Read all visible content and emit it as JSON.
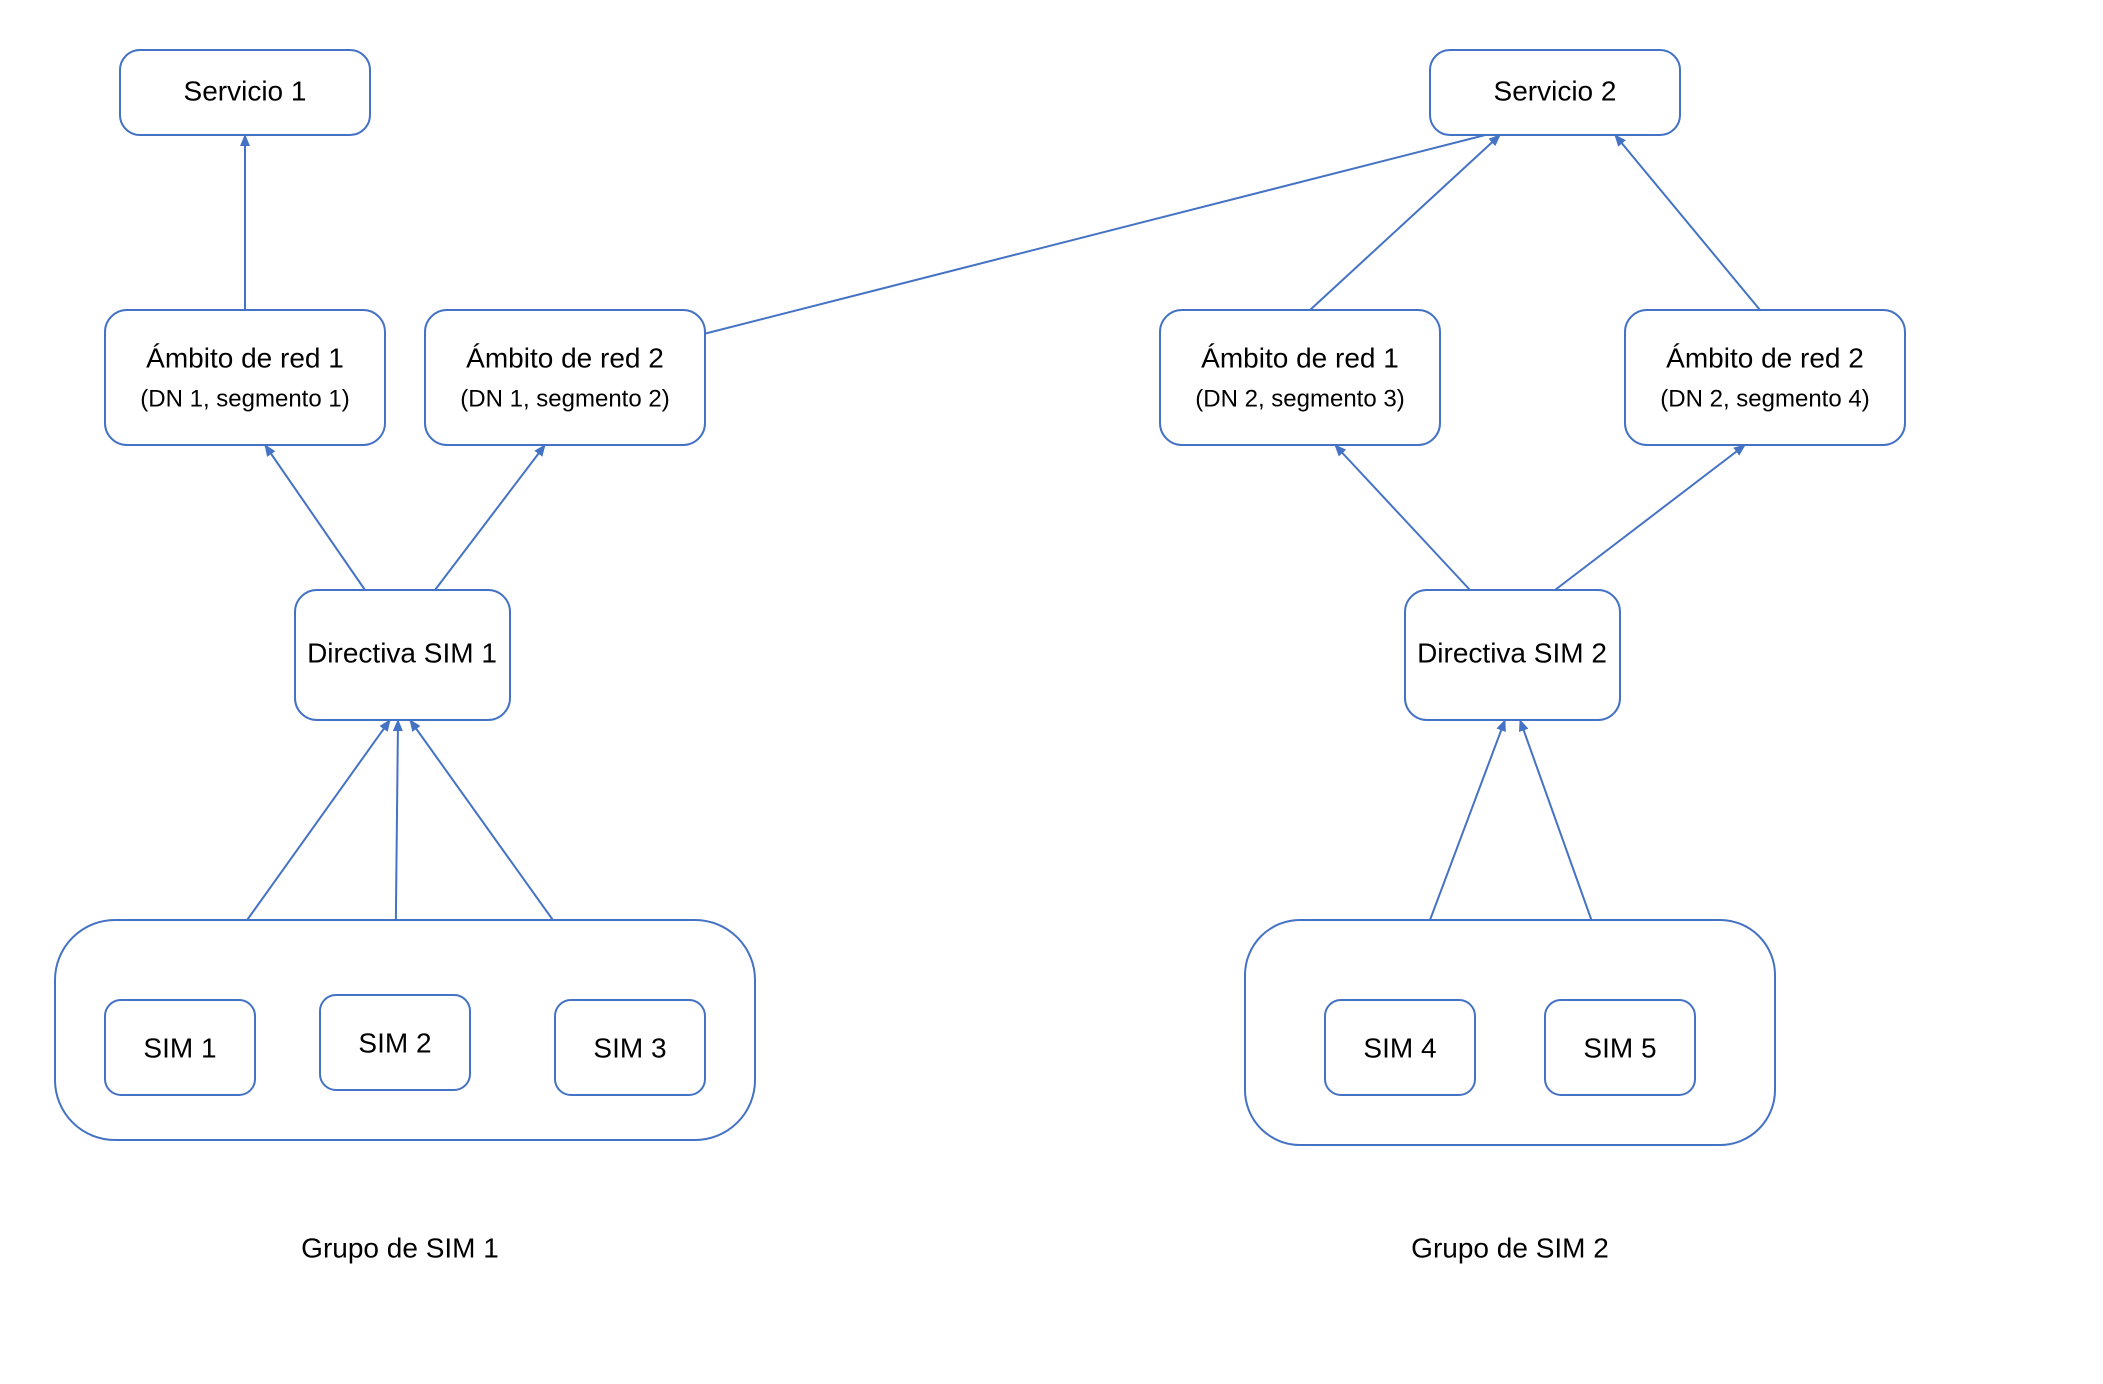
{
  "colors": {
    "stroke": "#4472C4",
    "text": "#000000"
  },
  "nodes": {
    "service1": {
      "label": "Servicio 1"
    },
    "service2": {
      "label": "Servicio 2"
    },
    "scope1_1": {
      "title": "Ámbito de red 1",
      "sub": "(DN 1, segmento 1)"
    },
    "scope1_2": {
      "title": "Ámbito de red 2",
      "sub": "(DN 1, segmento 2)"
    },
    "scope2_1": {
      "title": "Ámbito de red 1",
      "sub": "(DN 2, segmento 3)"
    },
    "scope2_2": {
      "title": "Ámbito de red 2",
      "sub": "(DN 2, segmento 4)"
    },
    "policy1": {
      "label": "Directiva SIM 1"
    },
    "policy2": {
      "label": "Directiva SIM 2"
    },
    "sim1": {
      "label": "SIM 1"
    },
    "sim2": {
      "label": "SIM 2"
    },
    "sim3": {
      "label": "SIM 3"
    },
    "sim4": {
      "label": "SIM 4"
    },
    "sim5": {
      "label": "SIM 5"
    }
  },
  "groups": {
    "group1": {
      "label": "Grupo de SIM 1"
    },
    "group2": {
      "label": "Grupo de SIM 2"
    }
  },
  "edges_desc": [
    "scope1_1 -> service1",
    "scope1_2 -> service2",
    "scope2_1 -> service2",
    "scope2_2 -> service2",
    "policy1 -> scope1_1",
    "policy1 -> scope1_2",
    "policy2 -> scope2_1",
    "policy2 -> scope2_2",
    "sim1 -> policy1",
    "sim2 -> policy1",
    "sim3 -> policy1",
    "sim4 -> policy2",
    "sim5 -> policy2"
  ]
}
